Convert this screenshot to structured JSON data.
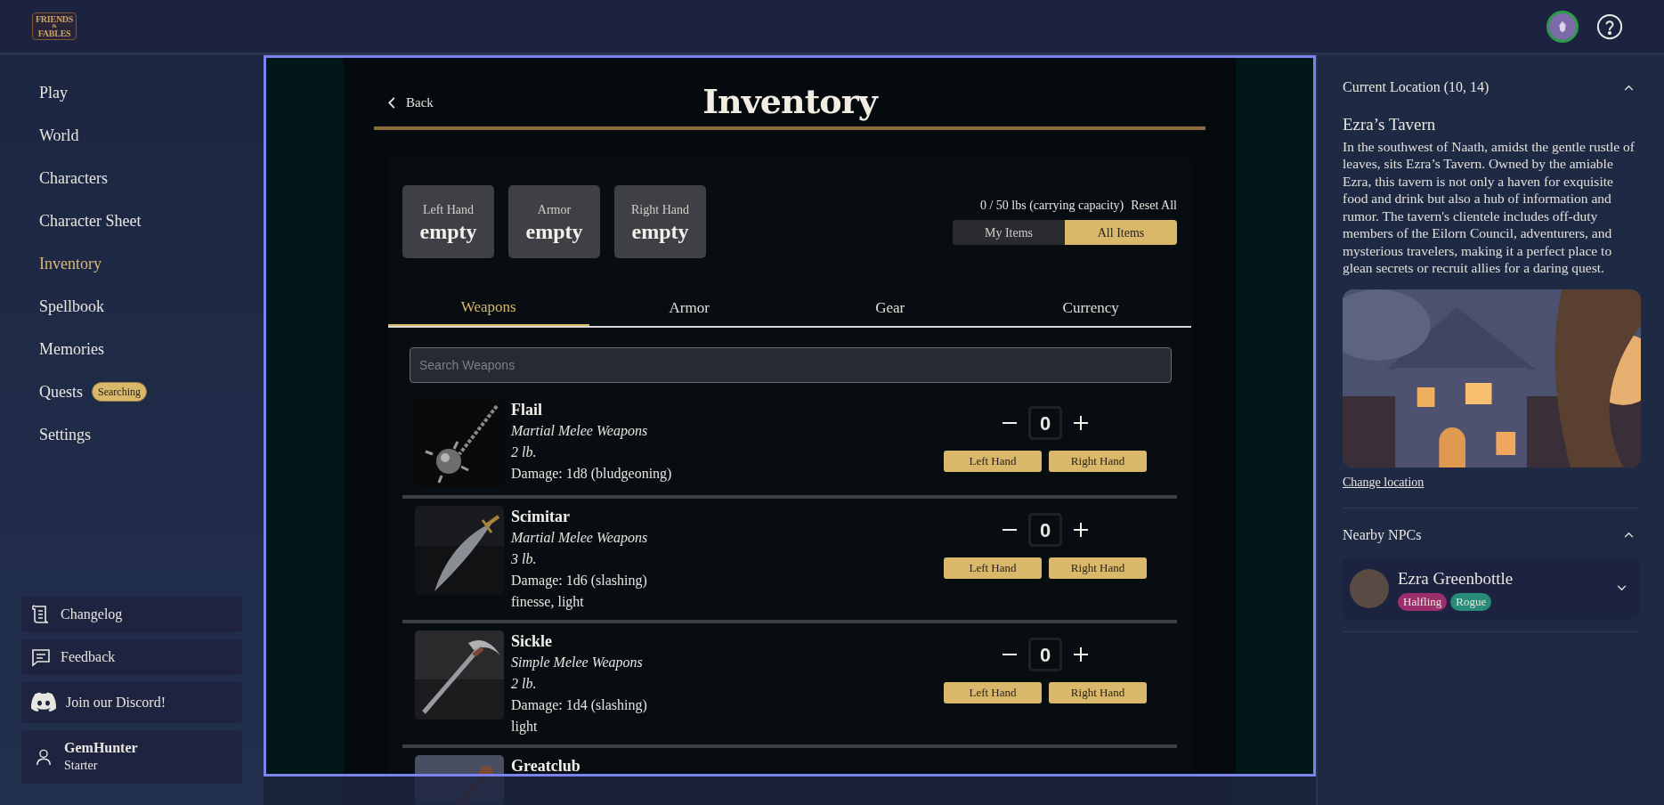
{
  "header": {
    "logo": [
      "FRIENDS",
      "&",
      "FABLES"
    ]
  },
  "nav": [
    {
      "label": "Play",
      "selected": false
    },
    {
      "label": "World",
      "selected": false
    },
    {
      "label": "Characters",
      "selected": false
    },
    {
      "label": "Character Sheet",
      "selected": false
    },
    {
      "label": "Inventory",
      "selected": true
    },
    {
      "label": "Spellbook",
      "selected": false
    },
    {
      "label": "Memories",
      "selected": false
    },
    {
      "label": "Quests",
      "selected": false,
      "badge": "Searching"
    },
    {
      "label": "Settings",
      "selected": false
    }
  ],
  "sidebar_links": [
    {
      "kind": "changelog",
      "label": "Changelog"
    },
    {
      "kind": "feedback",
      "label": "Feedback"
    },
    {
      "kind": "discord",
      "label": "Join our Discord!"
    }
  ],
  "user": {
    "name": "GemHunter",
    "plan": "Starter"
  },
  "inventory": {
    "back": "Back",
    "title": "Inventory",
    "slots": [
      {
        "label": "Left Hand",
        "value": "empty"
      },
      {
        "label": "Armor",
        "value": "empty"
      },
      {
        "label": "Right Hand",
        "value": "empty"
      }
    ],
    "capacity": "0 / 50 lbs (carrying capacity)",
    "reset": "Reset All",
    "filters": [
      {
        "label": "My Items",
        "selected": false
      },
      {
        "label": "All Items",
        "selected": true
      }
    ],
    "tabs": [
      {
        "label": "Weapons",
        "selected": true
      },
      {
        "label": "Armor",
        "selected": false
      },
      {
        "label": "Gear",
        "selected": false
      },
      {
        "label": "Currency",
        "selected": false
      }
    ],
    "search": {
      "placeholder": "Search Weapons"
    },
    "items": [
      {
        "kind": "flail",
        "name": "Flail",
        "category": "Martial Melee Weapons",
        "weight": "2 lb.",
        "damage": "Damage: 1d8 (bludgeoning)",
        "quantity": "0",
        "actions": [
          "Left Hand",
          "Right Hand"
        ]
      },
      {
        "kind": "scimitar",
        "name": "Scimitar",
        "category": "Martial Melee Weapons",
        "weight": "3 lb.",
        "damage": "Damage: 1d6 (slashing)",
        "properties": "finesse, light",
        "quantity": "0",
        "actions": [
          "Left Hand",
          "Right Hand"
        ]
      },
      {
        "kind": "sickle",
        "name": "Sickle",
        "category": "Simple Melee Weapons",
        "weight": "2 lb.",
        "damage": "Damage: 1d4 (slashing)",
        "properties": "light",
        "quantity": "0",
        "actions": [
          "Left Hand",
          "Right Hand"
        ]
      },
      {
        "kind": "club",
        "name": "Greatclub"
      }
    ]
  },
  "location": {
    "heading": "Current Location (10, 14)",
    "expanded": true,
    "name": "Ezra’s Tavern",
    "description": "In the southwest of Naath, amidst the gentle rustle of leaves, sits Ezra’s Tavern. Owned by the amiable Ezra, this tavern is not only a haven for exquisite food and drink but also a hub of information and rumor. The tavern's clientele includes off-duty members of the Eilorn Council, adventurers, and mysterious travelers, making it a perfect place to glean secrets or recruit allies for a daring quest.",
    "change": "Change location"
  },
  "npcs": {
    "heading": "Nearby NPCs",
    "expanded": true,
    "list": [
      {
        "name": "Ezra Greenbottle",
        "expanded": false,
        "tags": [
          {
            "label": "Halfling",
            "color": "#9c2f6b"
          },
          {
            "label": "Rogue",
            "color": "#2a8a78"
          }
        ]
      }
    ]
  }
}
